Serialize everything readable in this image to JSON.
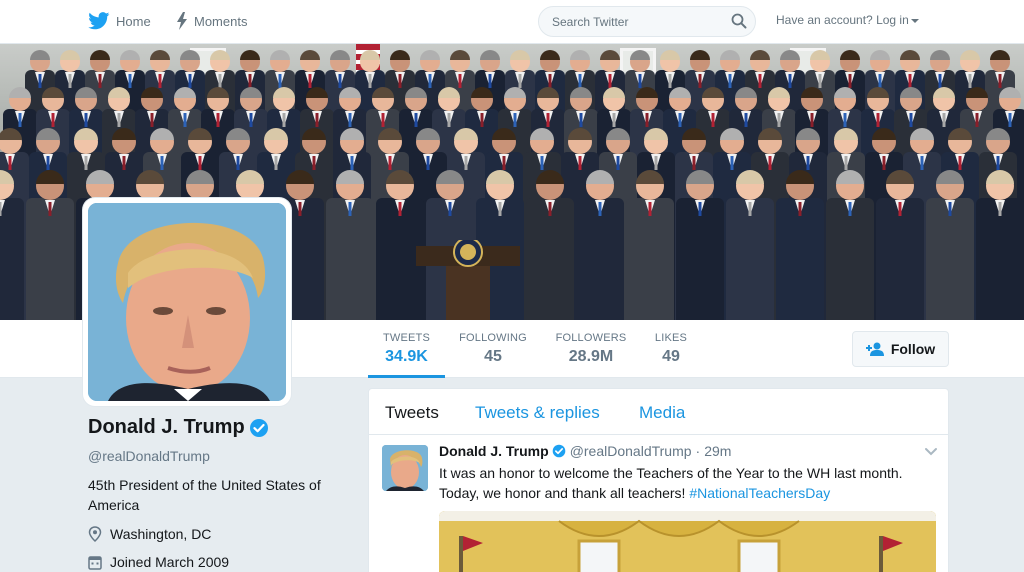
{
  "nav": {
    "home_label": "Home",
    "moments_label": "Moments",
    "search_placeholder": "Search Twitter",
    "login_label": "Have an account? Log in"
  },
  "stats": [
    {
      "label": "TWEETS",
      "value": "34.9K"
    },
    {
      "label": "FOLLOWING",
      "value": "45"
    },
    {
      "label": "FOLLOWERS",
      "value": "28.9M"
    },
    {
      "label": "LIKES",
      "value": "49"
    }
  ],
  "follow_label": "Follow",
  "profile": {
    "name": "Donald J. Trump",
    "handle": "@realDonaldTrump",
    "bio": "45th President of the United States of America",
    "location": "Washington, DC",
    "joined": "Joined March 2009"
  },
  "tabs": [
    "Tweets",
    "Tweets & replies",
    "Media"
  ],
  "tweet": {
    "name": "Donald J. Trump",
    "handle": "@realDonaldTrump",
    "separator": "·",
    "time": "29m",
    "text_main": "It was an honor to welcome the Teachers of the Year to the WH last month. Today, we honor and thank all teachers! ",
    "hashtag": "#NationalTeachersDay"
  },
  "colors": {
    "accent": "#1b95e0",
    "verified": "#1da1f2",
    "text": "#14171a",
    "muted": "#657786"
  }
}
